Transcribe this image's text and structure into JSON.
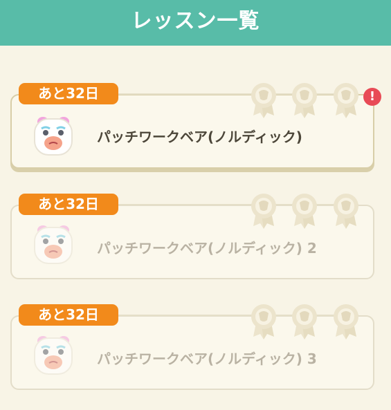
{
  "header": {
    "title": "レッスン一覧"
  },
  "lessons": [
    {
      "remaining": "あと32日",
      "title": "パッチワークベア(ノルディック)",
      "active": true,
      "alert": "!"
    },
    {
      "remaining": "あと32日",
      "title": "パッチワークベア(ノルディック) 2",
      "active": false
    },
    {
      "remaining": "あと32日",
      "title": "パッチワークベア(ノルディック) 3",
      "active": false
    }
  ],
  "colors": {
    "header_bg": "#58bca8",
    "badge_bg": "#f28a1b",
    "alert_bg": "#e84a56",
    "page_bg": "#f8f4e6"
  },
  "icons": {
    "medal": "medal-icon",
    "avatar": "hamster-avatar-icon",
    "alert": "alert-icon"
  }
}
